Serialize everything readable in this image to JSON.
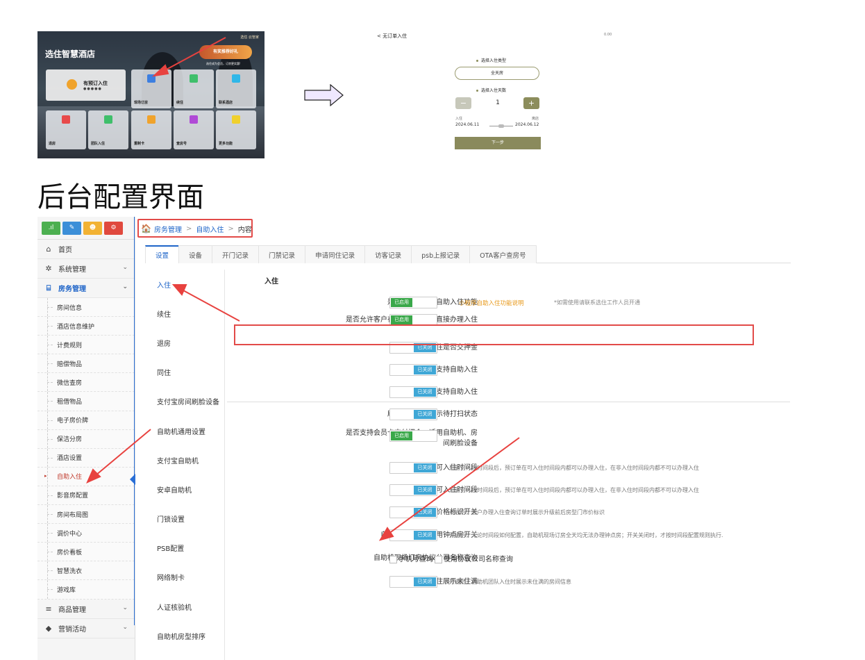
{
  "kiosk": {
    "title": "选住智慧酒店",
    "brand": "选住·云管家",
    "badge": "有奖推荐好礼",
    "sub": "选住成为会员，订房更实惠!",
    "tile_big": "有预订入住",
    "tiles": [
      "现场订房",
      "续住",
      "联系酒店",
      "退房",
      "团队入住",
      "重制卡",
      "查房号",
      "更多功能"
    ],
    "tile_colors": [
      "#3d7fe0",
      "#3fbf6b",
      "#2fb7e8",
      "#e84a4a",
      "#3fbf6b",
      "#f0a32c",
      "#b04ad6",
      "#f0d02c"
    ]
  },
  "phone": {
    "back": "< 无订单入住",
    "status": "0.00",
    "label_type": "选择入住类型",
    "type_value": "全天房",
    "label_days": "选择入住天数",
    "minus": "−",
    "plus": "+",
    "days": "1",
    "checkin_label": "入住",
    "checkout_label": "离店",
    "checkin_date": "2024.06.11",
    "checkout_date": "2024.06.12",
    "next": "下一步"
  },
  "section_title": "后台配置界面",
  "sidebar": {
    "menu": [
      {
        "label": "首页",
        "icon": "home-icon",
        "glyph": "⌂"
      },
      {
        "label": "系统管理",
        "icon": "gear-icon",
        "glyph": "✲"
      },
      {
        "label": "房务管理",
        "icon": "bank-icon",
        "glyph": "⌸"
      }
    ],
    "submenu": [
      "房间信息",
      "酒店信息维护",
      "计费规则",
      "赔偿物品",
      "微信查房",
      "租借物品",
      "电子房价牌",
      "保洁分房",
      "酒店设置",
      "自助入住",
      "影音房配置",
      "房间布局图",
      "调价中心",
      "房价看板",
      "智慧洗衣",
      "游戏库"
    ],
    "selected": "自助入住",
    "bottom": [
      {
        "label": "商品管理",
        "glyph": "≡"
      },
      {
        "label": "营销活动",
        "glyph": "◆"
      }
    ]
  },
  "breadcrumb": {
    "home": "🏠",
    "items": [
      "房务管理",
      "自助入住"
    ],
    "current": "内容"
  },
  "tabs": [
    "设置",
    "设备",
    "开门记录",
    "门禁记录",
    "申请同住记录",
    "访客记录",
    "psb上报记录",
    "OTA客户查房号"
  ],
  "left_nav": [
    "入住",
    "续住",
    "退房",
    "同住",
    "支付宝房间刷脸设备",
    "自助机通用设置",
    "支付宝自助机",
    "安卓自助机",
    "门锁设置",
    "PSB配置",
    "网络制卡",
    "人证核验机",
    "自助机房型排序"
  ],
  "content": {
    "heading": "入住",
    "on_text": "已启用",
    "off_text": "已关闭",
    "rows": [
      {
        "label": "是否开启小程序自助入住功能",
        "state": "on",
        "link": "小程序自助入住功能说明",
        "note": "*如需使用请联系选住工作人员开通"
      },
      {
        "label": "是否允许客户在房间刷脸设备直接办理入住",
        "state": "on"
      },
      {
        "label": "自助入住是否交押金",
        "state": "off"
      },
      {
        "label": "未成年人不支持自助入住",
        "state": "off"
      },
      {
        "label": "新疆客人不支持自助入住",
        "state": "off"
      },
      {
        "label": "刷脸设备是否显示待打扫状态",
        "state": "off"
      },
      {
        "label": "是否支持会员卡支付押金，适用自助机、房间刷脸设备",
        "state": "on"
      },
      {
        "label": "刷脸设备设置可入住时间段",
        "state": "off",
        "desc": "开启可入住时间段后，预订单在可入住时间段内都可以办理入住，在非入住时间段内都不可以办理入住"
      },
      {
        "label": "自助机设置可入住时间段",
        "state": "off",
        "desc": "开启可入住时间段后，预订单在可入住时间段内都可以办理入住，在非入住时间段内都不可以办理入住"
      },
      {
        "label": "免费升级房型价格标识开关",
        "state": "off",
        "desc": "开启后，客户办理入住查询订单时展示升级前后房型门市价标识"
      },
      {
        "label": "自助机现场订房禁用钟点房开关",
        "state": "off",
        "desc": "开启后，无论时间段如何配置，自助机现场订房全天均无法办理钟点房；开关关闭时，才按时间段配置规则执行."
      },
      {
        "label": "自助机现场订房协议公司名称查询",
        "state": "checkbox",
        "options": [
          "手机号查询",
          "使用协议公司名称查询"
        ]
      },
      {
        "label": "自助机团队入住展示未住满",
        "state": "off",
        "desc": "开启后，自助机团队入住时展示未住满的房间信息"
      }
    ]
  },
  "colors": {
    "accent": "#1e64c8",
    "enabled": "#3aa84a",
    "disabled": "#3fa7d6",
    "highlight": "#e24a48",
    "link": "#e89a1c"
  }
}
